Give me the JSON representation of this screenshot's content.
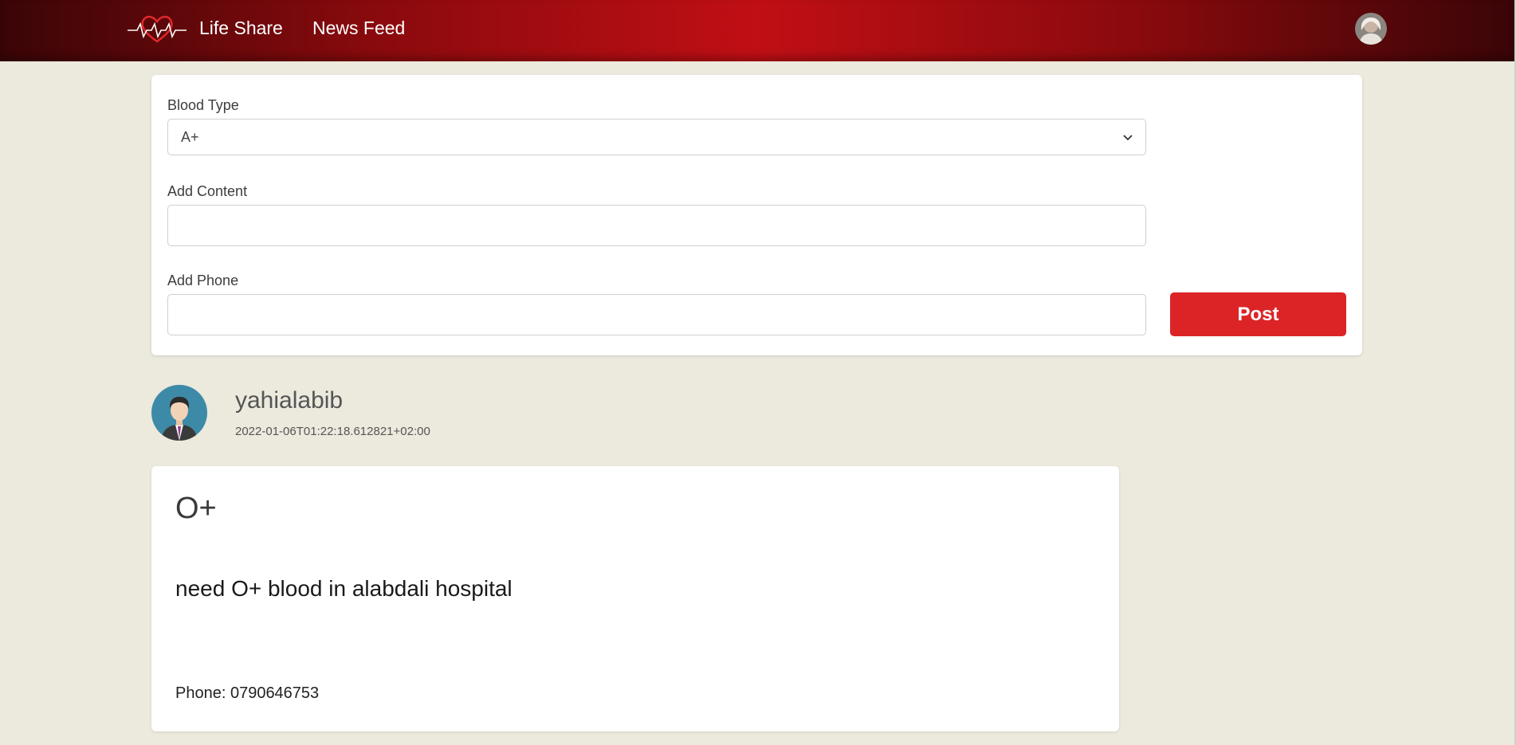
{
  "nav": {
    "brand": "Life Share",
    "news_feed": "News Feed",
    "logo_icon": "heart-pulse-icon",
    "avatar_icon": "user-avatar"
  },
  "form": {
    "blood_type_label": "Blood Type",
    "blood_type_value": "A+",
    "content_label": "Add Content",
    "content_value": "",
    "phone_label": "Add Phone",
    "phone_value": "",
    "post_label": "Post"
  },
  "post": {
    "username": "yahialabib",
    "timestamp": "2022-01-06T01:22:18.612821+02:00",
    "blood_type": "O+",
    "content": "need O+ blood in alabdali hospital",
    "phone": "Phone: 0790646753"
  },
  "colors": {
    "accent": "#dc2426",
    "navbar": "#c00f15",
    "background": "#ece9dd"
  }
}
